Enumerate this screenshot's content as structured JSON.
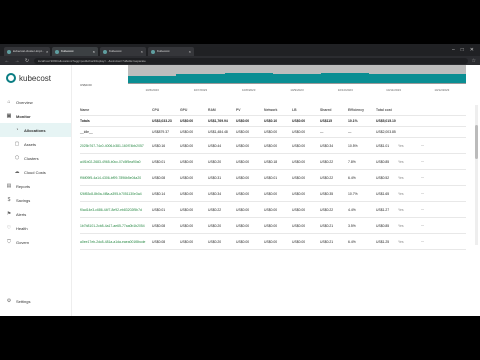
{
  "tabs": [
    {
      "title": "kubecost-cluster-tmpl...",
      "active": false
    },
    {
      "title": "Kubecost",
      "active": true
    },
    {
      "title": "Kubecost",
      "active": false
    },
    {
      "title": "Kubecost",
      "active": false
    }
  ],
  "url": "localhost:9090/allocations?agg=pod&chartDisplay=...&window=7d&idle=separate",
  "logo": "kubecost",
  "sidebar": {
    "items": [
      {
        "label": "Overview",
        "icon": "home-icon",
        "sub": false
      },
      {
        "label": "Monitor",
        "icon": "monitor-icon",
        "sub": false,
        "parent": true
      },
      {
        "label": "Allocations",
        "icon": "pie-icon",
        "sub": true,
        "active": true
      },
      {
        "label": "Assets",
        "icon": "box-icon",
        "sub": true
      },
      {
        "label": "Clusters",
        "icon": "cluster-icon",
        "sub": true
      },
      {
        "label": "Cloud Costs",
        "icon": "cloud-icon",
        "sub": true
      },
      {
        "label": "Reports",
        "icon": "report-icon",
        "sub": false
      },
      {
        "label": "Savings",
        "icon": "savings-icon",
        "sub": false
      },
      {
        "label": "Alerts",
        "icon": "bell-icon",
        "sub": false
      },
      {
        "label": "Health",
        "icon": "heart-icon",
        "sub": false
      },
      {
        "label": "Govern",
        "icon": "shield-icon",
        "sub": false
      }
    ],
    "settings": "Settings"
  },
  "chart_data": {
    "type": "bar",
    "ylabel": "US$0.00",
    "categories": [
      "10/6/2023",
      "10/7/2023",
      "10/8/2023",
      "10/9/2023",
      "10/10/2023",
      "10/11/2023",
      "10/12/2023"
    ],
    "values": [
      0.39,
      0.5,
      0.56,
      0.5,
      0.56,
      0.5,
      0.5
    ],
    "values_top": [
      1.0,
      1.0,
      1.0,
      1.0,
      1.0,
      1.0,
      1.0
    ]
  },
  "table": {
    "headers": [
      "Name",
      "CPU",
      "GPU",
      "RAM",
      "PV",
      "Network",
      "LB",
      "Shared",
      "Efficiency",
      "Total cost"
    ],
    "totals": [
      "Totals",
      "US$3,033.23",
      "US$0.00",
      "US$1,769.94",
      "US$0.00",
      "US$0.10",
      "US$0.00",
      "US$115",
      "10.1%",
      "US$5,015.10"
    ],
    "idle": [
      "__idle__",
      "US$879.37",
      "US$0.00",
      "US$1,484.48",
      "US$0.00",
      "US$0.00",
      "US$0.00",
      "—",
      "—",
      "US$2,003.85"
    ],
    "rows": [
      {
        "name": "2025b767-74c0-4006-b381-160f74bb2057",
        "cells": [
          "US$0.16",
          "US$0.00",
          "US$0.44",
          "US$0.00",
          "US$0.00",
          "US$0.00",
          "US$0.34",
          "10.5%",
          "US$1.01"
        ]
      },
      {
        "name": "a4f1b02-2683-4965-b0cc-07c5f5ea90a0",
        "cells": [
          "US$0.01",
          "US$0.00",
          "US$0.20",
          "US$0.00",
          "US$0.18",
          "US$0.00",
          "US$0.22",
          "7.8%",
          "US$0.85"
        ]
      },
      {
        "name": "f96f09f5-4a14-4306-bf99-7896b5e04a20",
        "cells": [
          "US$0.08",
          "US$0.00",
          "US$0.31",
          "US$0.00",
          "US$0.01",
          "US$0.00",
          "US$0.22",
          "6.4%",
          "US$0.52"
        ]
      },
      {
        "name": "f26f53c8-8b0a-4f8a-a395-b7051130e3a4",
        "cells": [
          "US$0.14",
          "US$0.00",
          "US$0.34",
          "US$0.00",
          "US$0.00",
          "US$0.00",
          "US$0.35",
          "10.7%",
          "US$1.65"
        ]
      },
      {
        "name": "f0ad14e3-c686-44f7-8e92-eb83202f5b7d",
        "cells": [
          "US$0.01",
          "US$0.00",
          "US$0.22",
          "US$0.00",
          "US$0.00",
          "US$0.00",
          "US$0.22",
          "4.4%",
          "US$1.27"
        ]
      },
      {
        "name": "1b7b8101-2cb8-4a17-ae65-77aa0b1b2054",
        "cells": [
          "US$0.08",
          "US$0.00",
          "US$0.20",
          "US$0.00",
          "US$0.00",
          "US$0.00",
          "US$0.21",
          "3.5%",
          "US$0.85"
        ]
      },
      {
        "name": "a0ee17eb-2dc8-481a-a1da-eaea001f8bcde",
        "cells": [
          "US$0.08",
          "US$0.00",
          "US$0.20",
          "US$0.00",
          "US$0.00",
          "US$0.00",
          "US$0.21",
          "6.4%",
          "US$1.25"
        ]
      }
    ],
    "action_label": "Yes",
    "menu_icon": "more-icon"
  },
  "colors": {
    "accent": "#0a8e93",
    "link": "#2a8a46",
    "bar_gray": "#bdbdbd"
  }
}
